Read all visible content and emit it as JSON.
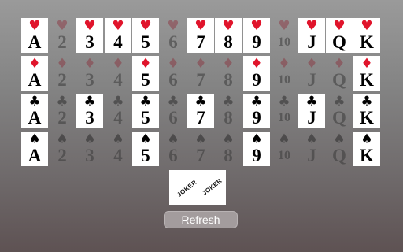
{
  "ranks": [
    "A",
    "2",
    "3",
    "4",
    "5",
    "6",
    "7",
    "8",
    "9",
    "10",
    "J",
    "Q",
    "K"
  ],
  "rows": [
    {
      "suit": "hearts",
      "symbol": "♥",
      "color": "red",
      "present": [
        true,
        false,
        true,
        true,
        true,
        false,
        true,
        true,
        true,
        false,
        true,
        true,
        true
      ]
    },
    {
      "suit": "diamonds",
      "symbol": "♦",
      "color": "red",
      "present": [
        true,
        false,
        false,
        false,
        true,
        false,
        false,
        false,
        true,
        false,
        false,
        false,
        true
      ]
    },
    {
      "suit": "clubs",
      "symbol": "♣",
      "color": "black",
      "present": [
        true,
        false,
        true,
        false,
        true,
        false,
        true,
        false,
        true,
        false,
        true,
        false,
        true
      ]
    },
    {
      "suit": "spades",
      "symbol": "♠",
      "color": "black",
      "present": [
        true,
        false,
        false,
        false,
        true,
        false,
        false,
        false,
        true,
        false,
        false,
        false,
        true
      ]
    }
  ],
  "joker": {
    "text_left": "JOKER",
    "text_right": "JOKER"
  },
  "refresh_label": "Refresh",
  "colors": {
    "red_suit": "#e0142b",
    "black_suit": "#000000",
    "card": "#ffffff"
  }
}
